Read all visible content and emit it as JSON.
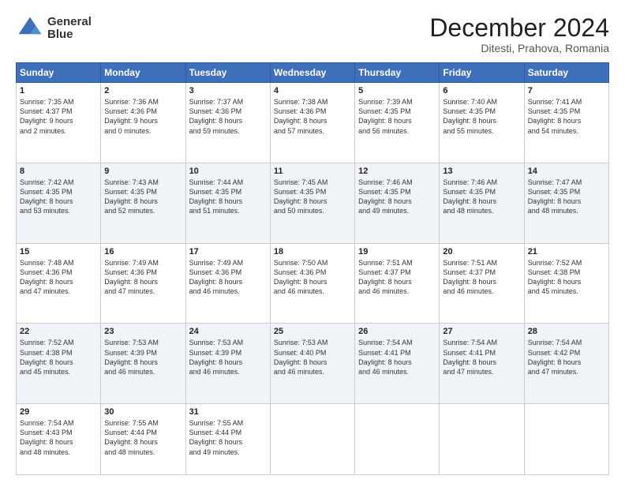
{
  "header": {
    "logo_line1": "General",
    "logo_line2": "Blue",
    "month": "December 2024",
    "location": "Ditesti, Prahova, Romania"
  },
  "weekdays": [
    "Sunday",
    "Monday",
    "Tuesday",
    "Wednesday",
    "Thursday",
    "Friday",
    "Saturday"
  ],
  "weeks": [
    [
      {
        "day": "1",
        "info": "Sunrise: 7:35 AM\nSunset: 4:37 PM\nDaylight: 9 hours\nand 2 minutes."
      },
      {
        "day": "2",
        "info": "Sunrise: 7:36 AM\nSunset: 4:36 PM\nDaylight: 9 hours\nand 0 minutes."
      },
      {
        "day": "3",
        "info": "Sunrise: 7:37 AM\nSunset: 4:36 PM\nDaylight: 8 hours\nand 59 minutes."
      },
      {
        "day": "4",
        "info": "Sunrise: 7:38 AM\nSunset: 4:36 PM\nDaylight: 8 hours\nand 57 minutes."
      },
      {
        "day": "5",
        "info": "Sunrise: 7:39 AM\nSunset: 4:35 PM\nDaylight: 8 hours\nand 56 minutes."
      },
      {
        "day": "6",
        "info": "Sunrise: 7:40 AM\nSunset: 4:35 PM\nDaylight: 8 hours\nand 55 minutes."
      },
      {
        "day": "7",
        "info": "Sunrise: 7:41 AM\nSunset: 4:35 PM\nDaylight: 8 hours\nand 54 minutes."
      }
    ],
    [
      {
        "day": "8",
        "info": "Sunrise: 7:42 AM\nSunset: 4:35 PM\nDaylight: 8 hours\nand 53 minutes."
      },
      {
        "day": "9",
        "info": "Sunrise: 7:43 AM\nSunset: 4:35 PM\nDaylight: 8 hours\nand 52 minutes."
      },
      {
        "day": "10",
        "info": "Sunrise: 7:44 AM\nSunset: 4:35 PM\nDaylight: 8 hours\nand 51 minutes."
      },
      {
        "day": "11",
        "info": "Sunrise: 7:45 AM\nSunset: 4:35 PM\nDaylight: 8 hours\nand 50 minutes."
      },
      {
        "day": "12",
        "info": "Sunrise: 7:46 AM\nSunset: 4:35 PM\nDaylight: 8 hours\nand 49 minutes."
      },
      {
        "day": "13",
        "info": "Sunrise: 7:46 AM\nSunset: 4:35 PM\nDaylight: 8 hours\nand 48 minutes."
      },
      {
        "day": "14",
        "info": "Sunrise: 7:47 AM\nSunset: 4:35 PM\nDaylight: 8 hours\nand 48 minutes."
      }
    ],
    [
      {
        "day": "15",
        "info": "Sunrise: 7:48 AM\nSunset: 4:36 PM\nDaylight: 8 hours\nand 47 minutes."
      },
      {
        "day": "16",
        "info": "Sunrise: 7:49 AM\nSunset: 4:36 PM\nDaylight: 8 hours\nand 47 minutes."
      },
      {
        "day": "17",
        "info": "Sunrise: 7:49 AM\nSunset: 4:36 PM\nDaylight: 8 hours\nand 46 minutes."
      },
      {
        "day": "18",
        "info": "Sunrise: 7:50 AM\nSunset: 4:36 PM\nDaylight: 8 hours\nand 46 minutes."
      },
      {
        "day": "19",
        "info": "Sunrise: 7:51 AM\nSunset: 4:37 PM\nDaylight: 8 hours\nand 46 minutes."
      },
      {
        "day": "20",
        "info": "Sunrise: 7:51 AM\nSunset: 4:37 PM\nDaylight: 8 hours\nand 46 minutes."
      },
      {
        "day": "21",
        "info": "Sunrise: 7:52 AM\nSunset: 4:38 PM\nDaylight: 8 hours\nand 45 minutes."
      }
    ],
    [
      {
        "day": "22",
        "info": "Sunrise: 7:52 AM\nSunset: 4:38 PM\nDaylight: 8 hours\nand 45 minutes."
      },
      {
        "day": "23",
        "info": "Sunrise: 7:53 AM\nSunset: 4:39 PM\nDaylight: 8 hours\nand 46 minutes."
      },
      {
        "day": "24",
        "info": "Sunrise: 7:53 AM\nSunset: 4:39 PM\nDaylight: 8 hours\nand 46 minutes."
      },
      {
        "day": "25",
        "info": "Sunrise: 7:53 AM\nSunset: 4:40 PM\nDaylight: 8 hours\nand 46 minutes."
      },
      {
        "day": "26",
        "info": "Sunrise: 7:54 AM\nSunset: 4:41 PM\nDaylight: 8 hours\nand 46 minutes."
      },
      {
        "day": "27",
        "info": "Sunrise: 7:54 AM\nSunset: 4:41 PM\nDaylight: 8 hours\nand 47 minutes."
      },
      {
        "day": "28",
        "info": "Sunrise: 7:54 AM\nSunset: 4:42 PM\nDaylight: 8 hours\nand 47 minutes."
      }
    ],
    [
      {
        "day": "29",
        "info": "Sunrise: 7:54 AM\nSunset: 4:43 PM\nDaylight: 8 hours\nand 48 minutes."
      },
      {
        "day": "30",
        "info": "Sunrise: 7:55 AM\nSunset: 4:44 PM\nDaylight: 8 hours\nand 48 minutes."
      },
      {
        "day": "31",
        "info": "Sunrise: 7:55 AM\nSunset: 4:44 PM\nDaylight: 8 hours\nand 49 minutes."
      },
      null,
      null,
      null,
      null
    ]
  ]
}
